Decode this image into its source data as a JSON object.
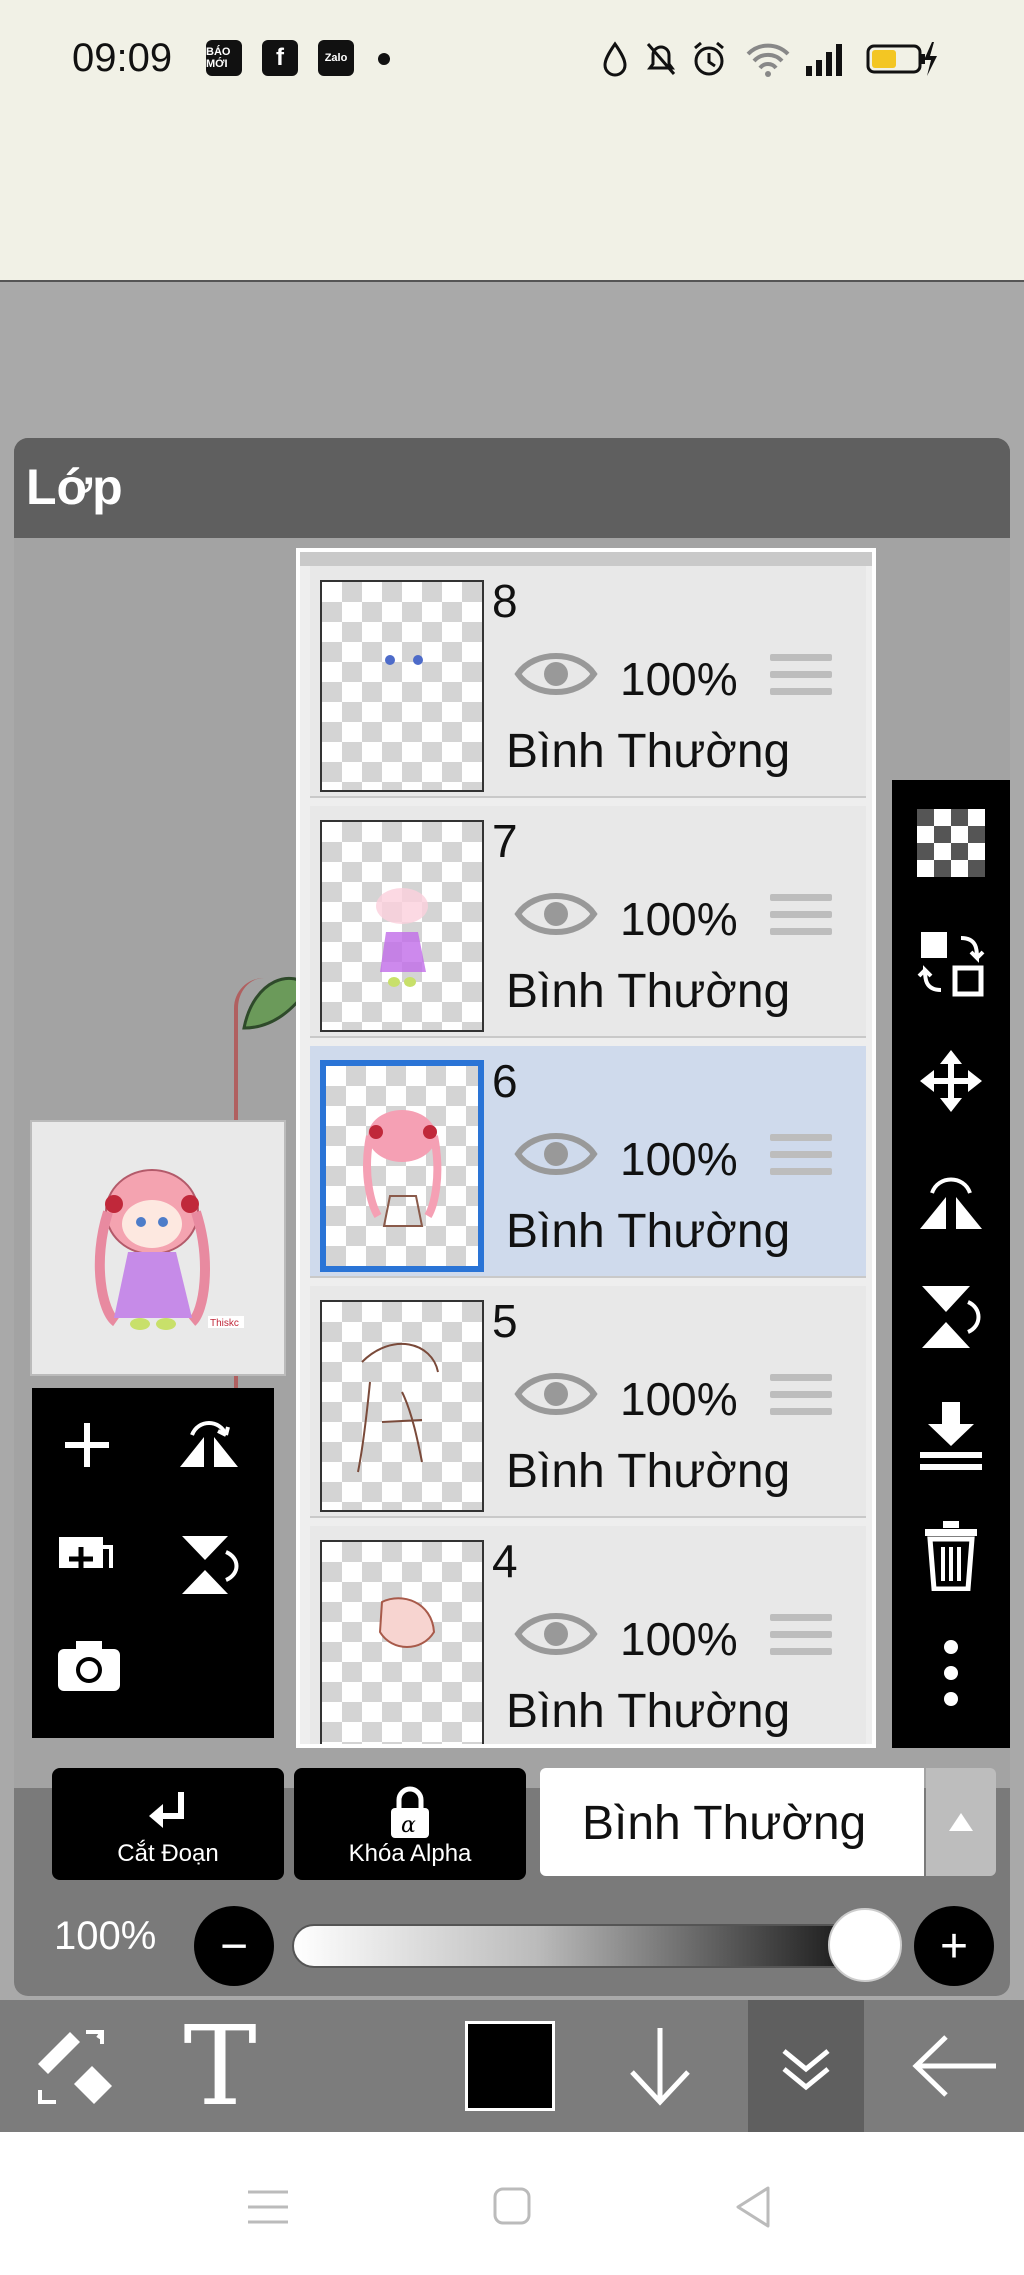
{
  "status_bar": {
    "time": "09:09",
    "notification_icons": [
      "Báo Mới",
      "Facebook",
      "Zalo"
    ],
    "notif_labels": {
      "baomoi": "BÁO MỚI",
      "facebook": "f",
      "zalo": "Zalo"
    },
    "right_icons": [
      "droplet-icon",
      "bell-muted-icon",
      "alarm-icon",
      "wifi-icon",
      "signal-icon",
      "battery-charging-icon"
    ]
  },
  "panel": {
    "title": "Lớp"
  },
  "layers": [
    {
      "number": "8",
      "opacity": "100%",
      "blend": "Bình Thường",
      "selected": false
    },
    {
      "number": "7",
      "opacity": "100%",
      "blend": "Bình Thường",
      "selected": false
    },
    {
      "number": "6",
      "opacity": "100%",
      "blend": "Bình Thường",
      "selected": true
    },
    {
      "number": "5",
      "opacity": "100%",
      "blend": "Bình Thường",
      "selected": false
    },
    {
      "number": "4",
      "opacity": "100%",
      "blend": "Bình Thường",
      "selected": false
    }
  ],
  "preview": {
    "signature": "Thiskc"
  },
  "right_toolbar": [
    "transparent-layer-icon",
    "swap-layer-icon",
    "move-icon",
    "flip-horizontal-icon",
    "flip-vertical-icon",
    "merge-down-icon",
    "trash-icon",
    "more-icon"
  ],
  "left_toolbar": [
    "add-layer-icon",
    "flip-horizontal-icon",
    "duplicate-layer-icon",
    "flip-vertical-icon",
    "camera-icon"
  ],
  "actions": {
    "clip_label": "Cắt Đoạn",
    "alpha_lock_label": "Khóa Alpha",
    "blend_mode": "Bình Thường"
  },
  "opacity": {
    "label": "100%",
    "value": 1.0,
    "minus": "−",
    "plus": "+"
  },
  "bottom_toolbar": [
    "transform-tool-icon",
    "text-tool-icon",
    "color-swatch",
    "arrow-down-icon",
    "collapse-icon",
    "back-arrow-icon"
  ],
  "bottom_text_tool": "T",
  "colors": {
    "primary_color": "#000000",
    "selected_layer_bg": "#cfdaec",
    "selected_border": "#2a74d6"
  },
  "nav_bar": [
    "menu-icon",
    "home-icon",
    "back-icon"
  ]
}
